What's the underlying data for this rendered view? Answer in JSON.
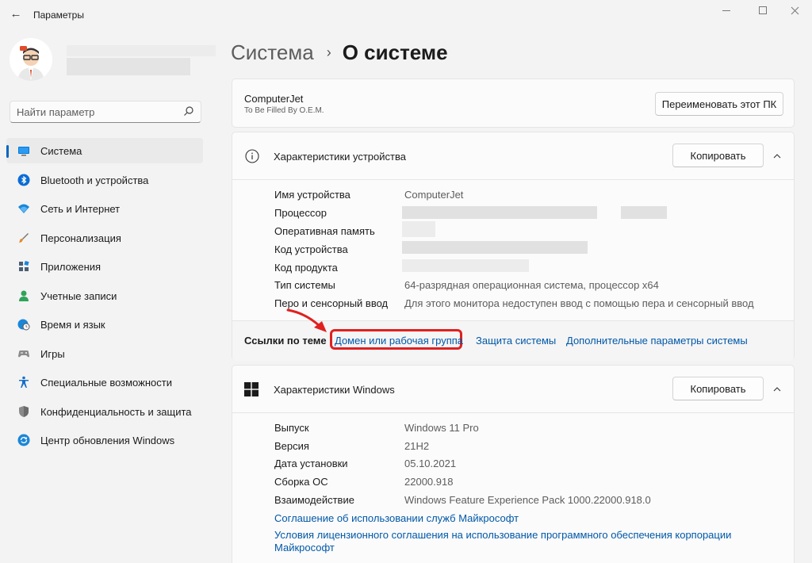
{
  "window": {
    "title": "Параметры"
  },
  "search": {
    "placeholder": "Найти параметр"
  },
  "sidebar": {
    "items": [
      {
        "label": "Система",
        "icon": "monitor-icon",
        "active": true
      },
      {
        "label": "Bluetooth и устройства",
        "icon": "bluetooth-icon"
      },
      {
        "label": "Сеть и Интернет",
        "icon": "wifi-icon"
      },
      {
        "label": "Персонализация",
        "icon": "brush-icon"
      },
      {
        "label": "Приложения",
        "icon": "apps-icon"
      },
      {
        "label": "Учетные записи",
        "icon": "person-icon"
      },
      {
        "label": "Время и язык",
        "icon": "globe-clock-icon"
      },
      {
        "label": "Игры",
        "icon": "gamepad-icon"
      },
      {
        "label": "Специальные возможности",
        "icon": "accessibility-icon"
      },
      {
        "label": "Конфиденциальность и защита",
        "icon": "shield-icon"
      },
      {
        "label": "Центр обновления Windows",
        "icon": "update-icon"
      }
    ]
  },
  "breadcrumb": {
    "parent": "Система",
    "current": "О системе"
  },
  "pc": {
    "name": "ComputerJet",
    "model": "To Be Filled By O.E.M.",
    "rename_label": "Переименовать этот ПК"
  },
  "device": {
    "title": "Характеристики устройства",
    "copy_label": "Копировать",
    "specs": [
      {
        "label": "Имя устройства",
        "value": "ComputerJet"
      },
      {
        "label": "Процессор",
        "value": ""
      },
      {
        "label": "Оперативная память",
        "value": ""
      },
      {
        "label": "Код устройства",
        "value": ""
      },
      {
        "label": "Код продукта",
        "value": ""
      },
      {
        "label": "Тип системы",
        "value": "64-разрядная операционная система, процессор x64"
      },
      {
        "label": "Перо и сенсорный ввод",
        "value": "Для этого монитора недоступен ввод с помощью пера и сенсорный ввод"
      }
    ]
  },
  "related": {
    "label": "Ссылки по теме",
    "links": [
      "Домен или рабочая группа",
      "Защита системы",
      "Дополнительные параметры системы"
    ]
  },
  "windows": {
    "title": "Характеристики Windows",
    "copy_label": "Копировать",
    "specs": [
      {
        "label": "Выпуск",
        "value": "Windows 11 Pro"
      },
      {
        "label": "Версия",
        "value": "21H2"
      },
      {
        "label": "Дата установки",
        "value": "05.10.2021"
      },
      {
        "label": "Сборка ОС",
        "value": "22000.918"
      },
      {
        "label": "Взаимодействие",
        "value": "Windows Feature Experience Pack 1000.22000.918.0"
      }
    ],
    "link1": "Соглашение об использовании служб Майкрософт",
    "link2_line1": "Условия лицензионного соглашения на использование программного обеспечения корпорации",
    "link2_line2": "Майкрософт"
  },
  "colors": {
    "accent": "#0067c0",
    "link": "#0058a8",
    "highlight": "#e02020"
  }
}
